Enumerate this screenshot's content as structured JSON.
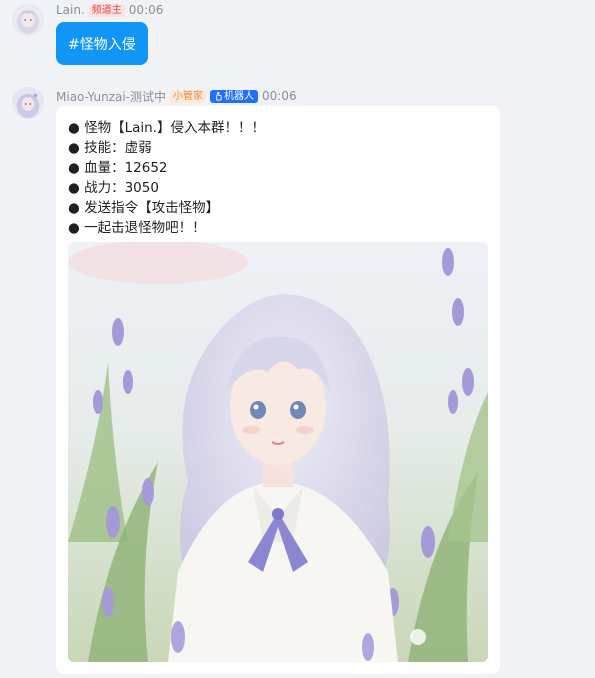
{
  "messages": [
    {
      "sender": "Lain.",
      "role_badge": "频道主",
      "time": "00:06",
      "text": "#怪物入侵"
    },
    {
      "sender": "Miao-Yunzai-测试中",
      "role_badge": "小管家",
      "bot_badge": "机器人",
      "time": "00:06",
      "lines": [
        "● 怪物【Lain.】侵入本群！！！",
        "● 技能：虚弱",
        "● 血量：12652",
        "● 战力：3050",
        "● 发送指令【攻击怪物】",
        "● 一起击退怪物吧！！"
      ]
    }
  ],
  "colors": {
    "page_bg": "#f1f2f5",
    "command_bubble": "#1296f6",
    "owner_badge": "#e5484d",
    "admin_badge": "#f08a3c",
    "bot_badge": "#1f6fff"
  },
  "icons": {
    "bot_badge_icon": "robot-hand-icon"
  }
}
